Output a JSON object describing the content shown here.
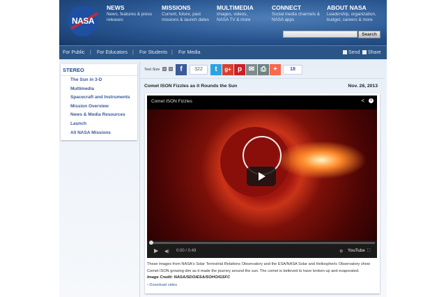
{
  "header": {
    "logo": "NASA",
    "nav": [
      {
        "title": "NEWS",
        "desc": "News, features & press releases"
      },
      {
        "title": "MISSIONS",
        "desc": "Current, future, past missions & launch dates"
      },
      {
        "title": "MULTIMEDIA",
        "desc": "Images, videos, NASA TV & more"
      },
      {
        "title": "CONNECT",
        "desc": "Social media channels & NASA apps"
      },
      {
        "title": "ABOUT NASA",
        "desc": "Leadership, organization, budget, careers & more"
      }
    ],
    "search_button": "Search",
    "search_value": ""
  },
  "subnav": {
    "items": [
      "For Public",
      "For Educators",
      "For Students",
      "For Media"
    ],
    "separator": "|",
    "send": "Send",
    "share": "Share"
  },
  "sidebar": {
    "heading": "STEREO",
    "items": [
      "The Sun in 3-D",
      "Multimedia",
      "Spacecraft and Instruments",
      "Mission Overview",
      "News & Media Resources",
      "Launch",
      "All NASA Missions"
    ]
  },
  "toolbar": {
    "text_size": "Text Size",
    "facebook_count": "322",
    "share_count": "18",
    "icons": {
      "facebook": "f",
      "twitter": "t",
      "gplus": "g+",
      "pinterest": "p",
      "email": "✉",
      "print": "⎙",
      "addthis": "+"
    }
  },
  "article": {
    "title": "Comet ISON Fizzles as it Rounds the Sun",
    "date": "Nov. 28, 2013"
  },
  "video": {
    "title": "Comet ISON Fizzles",
    "time": "0:00 / 0:49",
    "progress": 0,
    "youtube": "YouTube"
  },
  "caption": {
    "text": "These images from NASA's Solar Terrestrial Relations Observatory and the ESA/NASA Solar and Heliospheric Observatory show Comet ISON growing dim as it made the journey around the sun. The comet is believed to have broken up and evaporated.",
    "credit": "Image Credit: NASA/SDO/ESA/SOHO/GSFC",
    "download": "› Download video"
  }
}
